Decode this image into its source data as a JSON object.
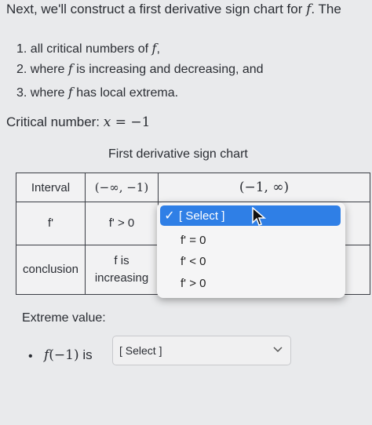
{
  "intro": {
    "text_before": "Next, we'll construct a first derivative sign chart for ",
    "f": "f",
    "text_after": ". The"
  },
  "list": [
    {
      "num": "1.",
      "text": "all critical numbers of ",
      "math": "f",
      "tail": ","
    },
    {
      "num": "2.",
      "pre": "where ",
      "math": "f",
      "text": " is increasing and decreasing, and"
    },
    {
      "num": "3.",
      "pre": "where ",
      "math": "f",
      "text": " has local extrema."
    }
  ],
  "critical": {
    "label": "Critical number: ",
    "var": "x",
    "eq": " = ",
    "value": "−1"
  },
  "chart_caption": "First derivative sign chart",
  "table": {
    "headers": [
      "Interval",
      "(−∞, −1)",
      "(−1, ∞)"
    ],
    "row_fprime": {
      "label": "f'",
      "left": "f' > 0"
    },
    "row_conclusion": {
      "label": "conclusion",
      "left_line1": "f is",
      "left_line2": "increasing"
    }
  },
  "dropdown": {
    "selected": "[ Select ]",
    "options": [
      "f' = 0",
      "f' < 0",
      "f' > 0"
    ]
  },
  "extreme": {
    "label": "Extreme value:",
    "item_math": "f",
    "item_arg": "(−1)",
    "item_is": " is",
    "select_placeholder": "[ Select ]"
  },
  "colors": {
    "accent": "#2f7fe6",
    "background": "#e9eaec"
  }
}
